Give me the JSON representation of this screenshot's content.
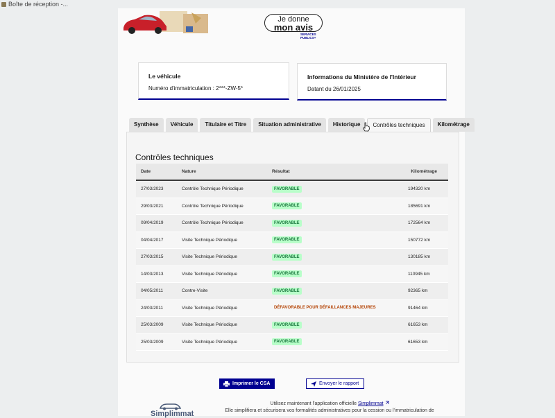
{
  "browser": {
    "tab_title": "Boîte de réception -..."
  },
  "header": {
    "avis_line1": "Je donne",
    "avis_line2": "mon avis",
    "services_line1": "SERVICES",
    "services_line2": "PUBLICS+"
  },
  "vehicle_card": {
    "title": "Le véhicule",
    "plate": "Numéro d'immatriculation : 2***-ZW-5*"
  },
  "ministry_card": {
    "title": "Informations du Ministère de l'Intérieur",
    "date": "Datant du 26/01/2025"
  },
  "tabs": [
    {
      "label": "Synthèse"
    },
    {
      "label": "Véhicule"
    },
    {
      "label": "Titulaire et Titre"
    },
    {
      "label": "Situation administrative"
    },
    {
      "label": "Historique"
    },
    {
      "label": "Contrôles techniques",
      "active": true
    },
    {
      "label": "Kilométrage"
    }
  ],
  "panel": {
    "title": "Contrôles techniques",
    "columns": {
      "date": "Date",
      "nature": "Nature",
      "result": "Résultat",
      "mileage": "Kilométrage"
    },
    "rows": [
      {
        "date": "27/03/2023",
        "nature": "Contrôle Technique Périodique",
        "result": "FAVORABLE",
        "status": "ok",
        "km": "194320 km"
      },
      {
        "date": "29/03/2021",
        "nature": "Contrôle Technique Périodique",
        "result": "FAVORABLE",
        "status": "ok",
        "km": "185691 km"
      },
      {
        "date": "09/04/2019",
        "nature": "Contrôle Technique Périodique",
        "result": "FAVORABLE",
        "status": "ok",
        "km": "172564 km"
      },
      {
        "date": "04/04/2017",
        "nature": "Visite Technique Périodique",
        "result": "FAVORABLE",
        "status": "ok",
        "km": "150772 km"
      },
      {
        "date": "27/03/2015",
        "nature": "Visite Technique Périodique",
        "result": "FAVORABLE",
        "status": "ok",
        "km": "130185 km"
      },
      {
        "date": "14/03/2013",
        "nature": "Visite Technique Périodique",
        "result": "FAVORABLE",
        "status": "ok",
        "km": "110945 km"
      },
      {
        "date": "04/05/2011",
        "nature": "Contre-Visite",
        "result": "FAVORABLE",
        "status": "ok",
        "km": "92365 km"
      },
      {
        "date": "24/03/2011",
        "nature": "Visite Technique Périodique",
        "result": "DÉFAVORABLE POUR DÉFAILLANCES MAJEURES",
        "status": "ko",
        "km": "91464 km"
      },
      {
        "date": "25/03/2009",
        "nature": "Visite Technique Périodique",
        "result": "FAVORABLE",
        "status": "ok",
        "km": "61653 km"
      },
      {
        "date": "25/03/2009",
        "nature": "Visite Technique Périodique",
        "result": "FAVORABLE",
        "status": "ok",
        "km": "61653 km"
      }
    ]
  },
  "actions": {
    "print_label": "Imprimer le CSA",
    "report_label": "Envoyer le rapport"
  },
  "footer": {
    "line1_pre": "Utilisez maintenant l'application officielle ",
    "line1_link": "Simplimmat",
    "line2": "Elle simplifiera et sécurisera vos formalités administratives pour la cession ou l'immatriculation de",
    "logo_text": "Simplimmat"
  },
  "colors": {
    "accent": "#000091",
    "favorable_bg": "#b8fec9",
    "favorable_text": "#18753c",
    "defavorable_text": "#b34000"
  }
}
